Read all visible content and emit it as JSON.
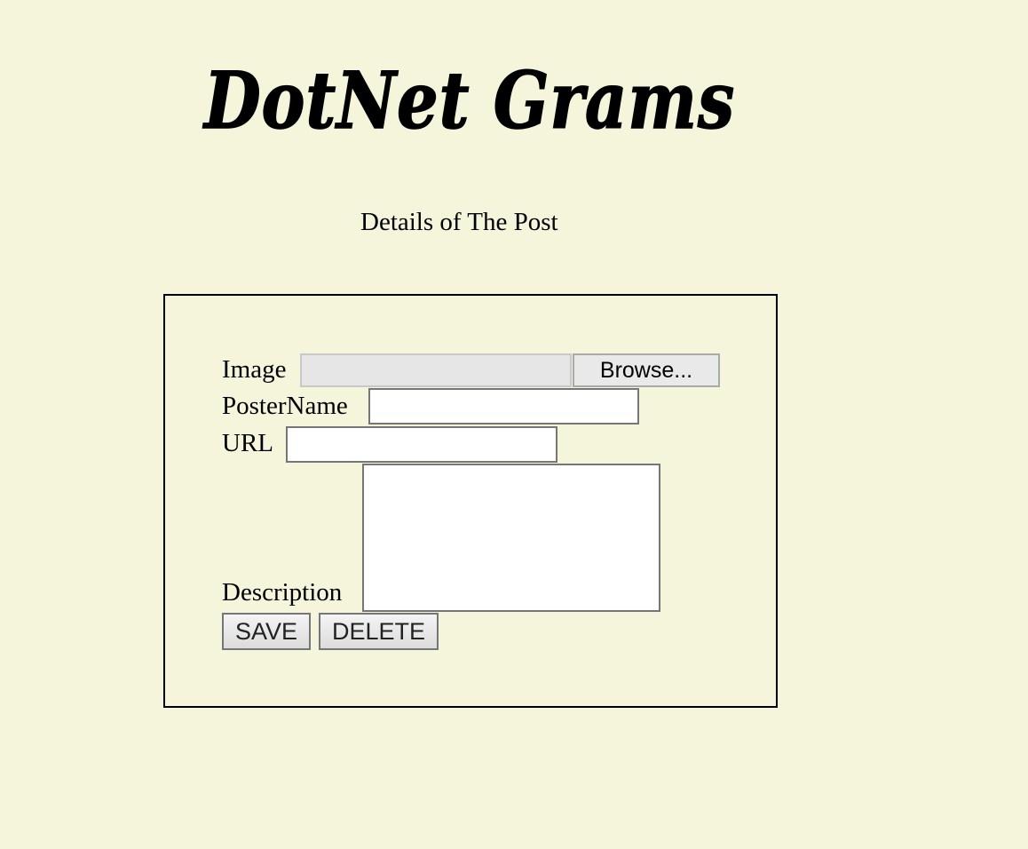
{
  "header": {
    "logo_text": "DotNet Grams",
    "subtitle": "Details of The Post"
  },
  "form": {
    "image_label": "Image",
    "browse_label": "Browse...",
    "poster_label": "PosterName",
    "poster_value": "",
    "url_label": "URL",
    "url_value": "",
    "description_label": "Description",
    "description_value": "",
    "save_label": "SAVE",
    "delete_label": "DELETE"
  },
  "colors": {
    "background": "#f5f5dc",
    "panel_border": "#000000",
    "input_border": "#767676"
  }
}
